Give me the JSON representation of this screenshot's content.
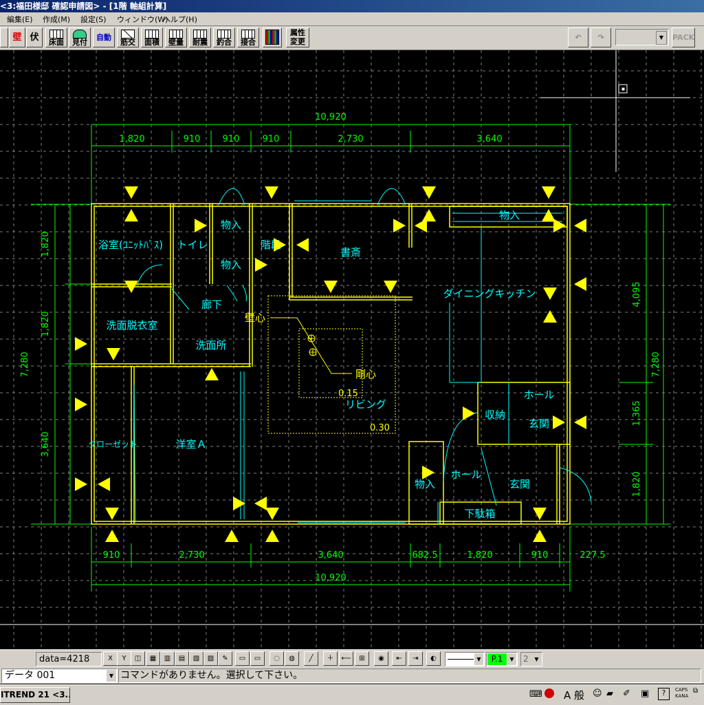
{
  "window": {
    "title": "<3:福田様邸 確認申請図> - [1階 軸組計算]"
  },
  "menu": [
    {
      "label": "編集(E)"
    },
    {
      "label": "作成(M)"
    },
    {
      "label": "設定(S)"
    },
    {
      "label": "ウィンドウ(W)"
    },
    {
      "label": "ヘルプ(H)"
    }
  ],
  "toolbar": {
    "buttons": [
      {
        "label": "壁"
      },
      {
        "label": "伏"
      },
      {
        "label": "床面"
      },
      {
        "label": "見付"
      },
      {
        "label": "自動"
      },
      {
        "label": "筋交"
      },
      {
        "label": "面積"
      },
      {
        "label": "壁量"
      },
      {
        "label": "耐震"
      },
      {
        "label": "釣合"
      },
      {
        "label": "接合"
      },
      {
        "label": "属性変更"
      }
    ],
    "pack_label": "PACK"
  },
  "drawing": {
    "dims_top_total": "10,920",
    "dims_top": [
      "1,820",
      "910",
      "910",
      "910",
      "2,730",
      "3,640"
    ],
    "dims_bottom_total": "10,920",
    "dims_bottom": [
      "910",
      "2,730",
      "3,640",
      "682.5",
      "1,820",
      "910",
      "227.5"
    ],
    "dims_left_total": "7,280",
    "dims_left": [
      "1,820",
      "1,820",
      "3,640"
    ],
    "dims_right_total": "7,280",
    "dims_right": [
      "4,095",
      "1,365",
      "1,820"
    ],
    "rooms": {
      "bath": "浴室(ﾕﾆｯﾄﾊﾞｽ)",
      "toilet": "トイレ",
      "storage1": "物入",
      "stairs": "階段",
      "storage2": "物入",
      "study": "書斎",
      "storage3": "物入",
      "hall_corridor": "廊下",
      "dressing": "洗面脱衣室",
      "washroom": "洗面所",
      "dining": "ダイニングキッチン",
      "closet": "クローゼット",
      "western_a": "洋室Ａ",
      "living": "リビング",
      "hall1": "ホール",
      "storage_closet": "収納",
      "entrance1": "玄関",
      "storage4": "物入",
      "hall2": "ホール",
      "entrance2": "玄関",
      "shoe_box": "下駄箱"
    },
    "wall_center_label": "壁心",
    "rigidity_center_label": "剛心",
    "eccentricity_x": "0.15",
    "eccentricity_y": "0.30"
  },
  "status": {
    "data_count": "data=4218",
    "layer_select": "P.1",
    "layer_num": "2"
  },
  "command": {
    "layer_name": "データ 001",
    "message": "コマンドがありません。選択して下さい。"
  },
  "taskbar": {
    "app_button": "ITREND 21 <3...",
    "ime_mode": "A 般",
    "caps": "CAPS",
    "kana": "KANA"
  },
  "colors": {
    "wall": "#ffff00",
    "dimension": "#00ff00",
    "text": "#00ffff",
    "arrow": "#ffff00",
    "grid": "#808080"
  }
}
